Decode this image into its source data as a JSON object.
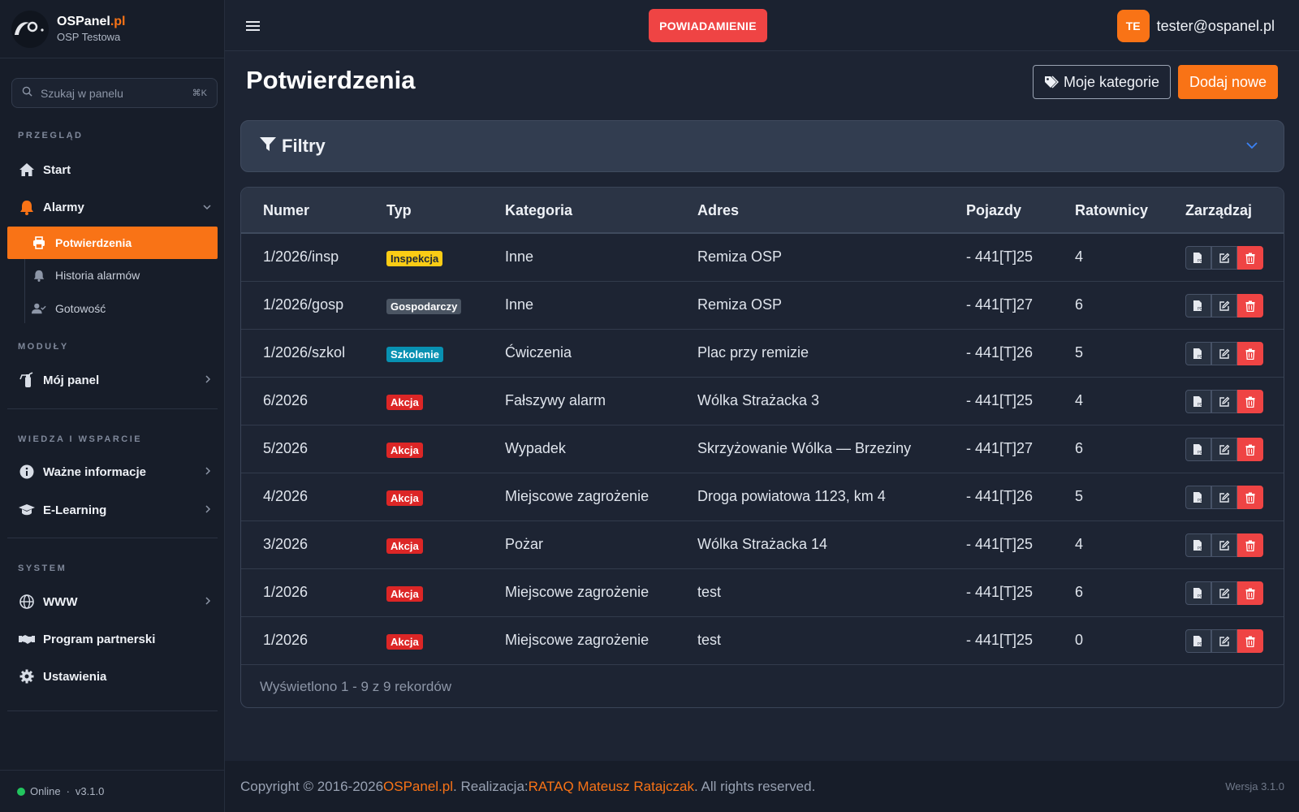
{
  "brand": {
    "name": "OSPanel",
    "tld": ".pl",
    "unit": "OSP Testowa"
  },
  "search": {
    "placeholder": "Szukaj w panelu",
    "shortcut": "⌘K"
  },
  "sidebar": {
    "sections": {
      "overview": "PRZEGLĄD",
      "modules": "MODUŁY",
      "knowledge": "WIEDZA I WSPARCIE",
      "system": "SYSTEM"
    },
    "items": {
      "start": "Start",
      "alarms": "Alarmy",
      "confirmations": "Potwierdzenia",
      "alarm_history": "Historia alarmów",
      "readiness": "Gotowość",
      "my_panel": "Mój panel",
      "important_info": "Ważne informacje",
      "elearning": "E-Learning",
      "www": "WWW",
      "partner": "Program partnerski",
      "settings": "Ustawienia"
    },
    "status": {
      "online": "Online",
      "separator": "·",
      "version": "v3.1.0"
    }
  },
  "header": {
    "notification_button": "POWIADAMIENIE",
    "user_initials": "TE",
    "user_email": "tester@ospanel.pl"
  },
  "main": {
    "title": "Potwierdzenia",
    "my_categories_button": "Moje kategorie",
    "add_new_button": "Dodaj nowe",
    "filters_label": "Filtry"
  },
  "table": {
    "columns": [
      "Numer",
      "Typ",
      "Kategoria",
      "Adres",
      "Pojazdy",
      "Ratownicy",
      "Zarządzaj"
    ],
    "rows": [
      {
        "numer": "1/2026/insp",
        "typ": "Inspekcja",
        "typ_color": "#facc15",
        "typ_text": "#1f2937",
        "kategoria": "Inne",
        "adres": "Remiza OSP",
        "pojazdy": "- 441[T]25",
        "ratownicy": "4"
      },
      {
        "numer": "1/2026/gosp",
        "typ": "Gospodarczy",
        "typ_color": "#4b5563",
        "typ_text": "#ffffff",
        "kategoria": "Inne",
        "adres": "Remiza OSP",
        "pojazdy": "- 441[T]27",
        "ratownicy": "6"
      },
      {
        "numer": "1/2026/szkol",
        "typ": "Szkolenie",
        "typ_color": "#0891b2",
        "typ_text": "#ffffff",
        "kategoria": "Ćwiczenia",
        "adres": "Plac przy remizie",
        "pojazdy": "- 441[T]26",
        "ratownicy": "5"
      },
      {
        "numer": "6/2026",
        "typ": "Akcja",
        "typ_color": "#dc2626",
        "typ_text": "#ffffff",
        "kategoria": "Fałszywy alarm",
        "adres": "Wólka Strażacka 3",
        "pojazdy": "- 441[T]25",
        "ratownicy": "4"
      },
      {
        "numer": "5/2026",
        "typ": "Akcja",
        "typ_color": "#dc2626",
        "typ_text": "#ffffff",
        "kategoria": "Wypadek",
        "adres": "Skrzyżowanie Wólka — Brzeziny",
        "pojazdy": "- 441[T]27",
        "ratownicy": "6"
      },
      {
        "numer": "4/2026",
        "typ": "Akcja",
        "typ_color": "#dc2626",
        "typ_text": "#ffffff",
        "kategoria": "Miejscowe zagrożenie",
        "adres": "Droga powiatowa 1123, km 4",
        "pojazdy": "- 441[T]26",
        "ratownicy": "5"
      },
      {
        "numer": "3/2026",
        "typ": "Akcja",
        "typ_color": "#dc2626",
        "typ_text": "#ffffff",
        "kategoria": "Pożar",
        "adres": "Wólka Strażacka 14",
        "pojazdy": "- 441[T]25",
        "ratownicy": "4"
      },
      {
        "numer": "1/2026",
        "typ": "Akcja",
        "typ_color": "#dc2626",
        "typ_text": "#ffffff",
        "kategoria": "Miejscowe zagrożenie",
        "adres": "test",
        "pojazdy": "- 441[T]25",
        "ratownicy": "6"
      },
      {
        "numer": "1/2026",
        "typ": "Akcja",
        "typ_color": "#dc2626",
        "typ_text": "#ffffff",
        "kategoria": "Miejscowe zagrożenie",
        "adres": "test",
        "pojazdy": "- 441[T]25",
        "ratownicy": "0"
      }
    ],
    "footer_text": "Wyświetlono 1 - 9 z 9 rekordów"
  },
  "footer": {
    "copyright": "Copyright © 2016-2026 ",
    "site": "OSPanel.pl",
    "realization": ". Realizacja: ",
    "author": "RATAQ Mateusz Ratajczak",
    "rights": ". All rights reserved.",
    "version": "Wersja 3.1.0"
  },
  "colors": {
    "accent": "#f97316",
    "danger": "#ef4444",
    "online": "#22c55e",
    "link": "#3b82f6"
  },
  "icons": [
    "logo-icon",
    "search-icon",
    "home-icon",
    "bell-icon",
    "chevron-down-icon",
    "print-icon",
    "bell-small-icon",
    "user-check-icon",
    "extinguisher-icon",
    "chevron-right-icon",
    "info-icon",
    "graduation-cap-icon",
    "globe-icon",
    "handshake-icon",
    "gear-icon",
    "hamburger-icon",
    "tags-icon",
    "filter-icon",
    "pdf-icon",
    "edit-icon",
    "trash-icon"
  ]
}
